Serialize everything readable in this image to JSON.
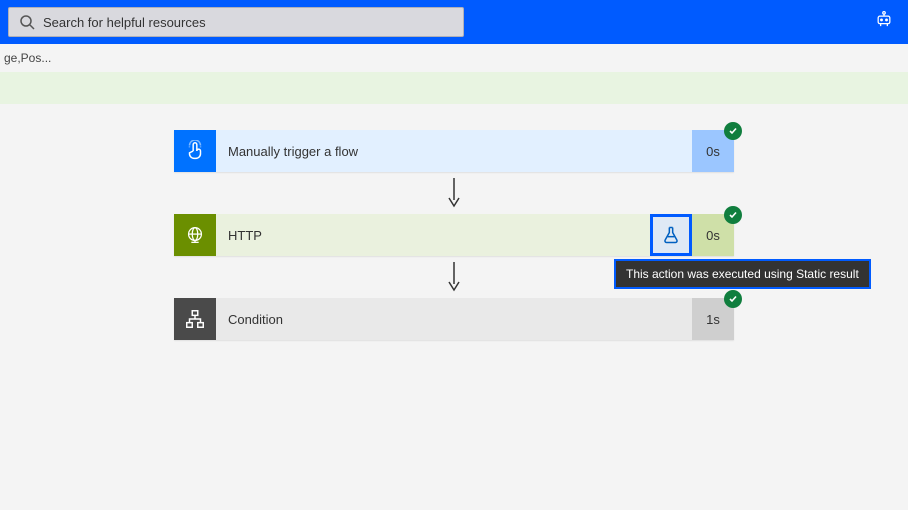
{
  "search": {
    "placeholder": "Search for helpful resources",
    "value": ""
  },
  "breadcrumb": {
    "truncated": "ge,Pos..."
  },
  "steps": {
    "trigger": {
      "title": "Manually trigger a flow",
      "duration": "0s"
    },
    "http": {
      "title": "HTTP",
      "duration": "0s"
    },
    "condition": {
      "title": "Condition",
      "duration": "1s"
    }
  },
  "tooltip": {
    "static_result": "This action was executed using Static result"
  }
}
